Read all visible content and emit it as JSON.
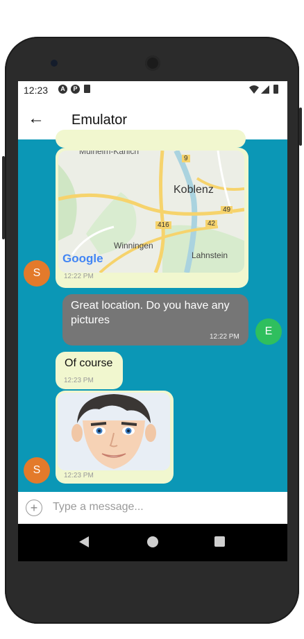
{
  "status_bar": {
    "time": "12:23",
    "icons": [
      "app-icon",
      "app-icon",
      "sd-card-icon",
      "wifi-icon",
      "signal-icon",
      "battery-icon"
    ]
  },
  "app_bar": {
    "title": "Emulator",
    "back_icon": "arrow-left-icon"
  },
  "colors": {
    "chat_background": "#0b97b6",
    "incoming_bubble": "#f1f7cf",
    "outgoing_bubble": "#767676",
    "avatar_s": "#e37a2b",
    "avatar_e": "#2fbf5e"
  },
  "messages": [
    {
      "sender": "S",
      "type": "map",
      "time": "12:22 PM",
      "map_labels": [
        "Mülheim-Kärlich",
        "Koblenz",
        "Winningen",
        "Lahnstein",
        "9",
        "49",
        "42",
        "416"
      ],
      "map_brand": "Google"
    },
    {
      "sender": "E",
      "type": "text",
      "text": "Great location. Do you have any pictures",
      "time": "12:22 PM"
    },
    {
      "sender": "S",
      "type": "text",
      "text": "Of course",
      "time": "12:23 PM"
    },
    {
      "sender": "S",
      "type": "image",
      "time": "12:23 PM"
    }
  ],
  "avatars": {
    "s": "S",
    "e": "E"
  },
  "input": {
    "placeholder": "Type a message..."
  }
}
